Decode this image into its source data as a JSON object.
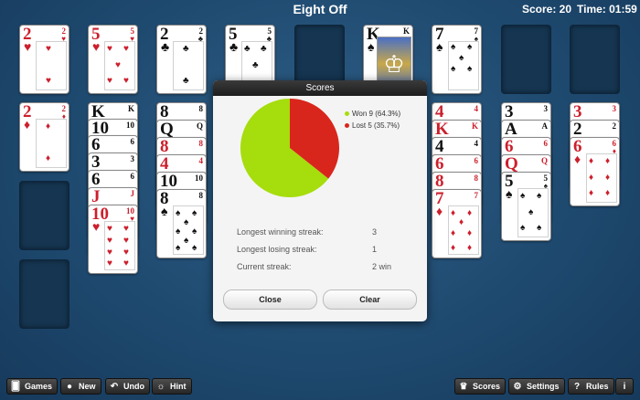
{
  "header": {
    "title": "Eight Off",
    "score": "Score: 20",
    "time": "Time: 01:59"
  },
  "cards": {
    "c2h": {
      "rank": "2",
      "suit": "♥"
    },
    "c5h": {
      "rank": "5",
      "suit": "♥"
    },
    "c2c": {
      "rank": "2",
      "suit": "♣"
    },
    "c5c": {
      "rank": "5",
      "suit": "♣"
    },
    "cks": {
      "rank": "K",
      "suit": "♠"
    },
    "c7s": {
      "rank": "7",
      "suit": "♠"
    },
    "c2d": {
      "rank": "2",
      "suit": "♦"
    },
    "ckh": {
      "rank": "K",
      "suit": "♥"
    },
    "c10s": {
      "rank": "10",
      "suit": "♠"
    },
    "c6s": {
      "rank": "6",
      "suit": "♠"
    },
    "c3s": {
      "rank": "3",
      "suit": "♠"
    },
    "c6c": {
      "rank": "6",
      "suit": "♣"
    },
    "cjh": {
      "rank": "J",
      "suit": "♥"
    },
    "c10h": {
      "rank": "10",
      "suit": "♥"
    },
    "c8s": {
      "rank": "8",
      "suit": "♠"
    },
    "cqd": {
      "rank": "Q",
      "suit": "♦"
    },
    "c8d": {
      "rank": "8",
      "suit": "♦"
    },
    "c4h": {
      "rank": "4",
      "suit": "♥"
    },
    "c10c": {
      "rank": "10",
      "suit": "♣"
    },
    "c8c": {
      "rank": "8",
      "suit": "♣"
    },
    "c4d": {
      "rank": "4",
      "suit": "♦"
    },
    "ckd": {
      "rank": "K",
      "suit": "♦"
    },
    "c4c": {
      "rank": "4",
      "suit": "♣"
    },
    "c6h": {
      "rank": "6",
      "suit": "♥"
    },
    "c8h": {
      "rank": "8",
      "suit": "♥"
    },
    "c7h": {
      "rank": "7",
      "suit": "♥"
    },
    "c3c": {
      "rank": "3",
      "suit": "♣"
    },
    "cas": {
      "rank": "A",
      "suit": "♠"
    },
    "c6d": {
      "rank": "6",
      "suit": "♦"
    },
    "cqh": {
      "rank": "Q",
      "suit": "♥"
    },
    "c5s": {
      "rank": "5",
      "suit": "♠"
    },
    "c3h": {
      "rank": "3",
      "suit": "♥"
    },
    "c2s": {
      "rank": "2",
      "suit": "♠"
    },
    "c6d2": {
      "rank": "6",
      "suit": "♦"
    }
  },
  "dialog": {
    "title": "Scores",
    "legend_won": "Won 9 (64.3%)",
    "legend_lost": "Lost 5 (35.7%)",
    "stats": [
      {
        "label": "Longest winning streak:",
        "value": "3"
      },
      {
        "label": "Longest losing streak:",
        "value": "1"
      },
      {
        "label": "Current streak:",
        "value": "2 win"
      }
    ],
    "close_label": "Close",
    "clear_label": "Clear"
  },
  "chart_data": {
    "type": "pie",
    "labels": [
      "Won",
      "Lost"
    ],
    "values": [
      9,
      5
    ],
    "percent": [
      64.3,
      35.7
    ],
    "colors": [
      "#a6dd0c",
      "#d9261c"
    ]
  },
  "toolbar": {
    "games": "Games",
    "new": "New",
    "undo": "Undo",
    "hint": "Hint",
    "scores": "Scores",
    "settings": "Settings",
    "rules": "Rules"
  },
  "icons": {
    "games": "cards-icon",
    "new": "circle-icon",
    "undo": "undo-arrow-icon",
    "hint": "lightbulb-icon",
    "scores": "crown-icon",
    "settings": "gear-icon",
    "rules": "question-icon",
    "info": "info-icon"
  }
}
